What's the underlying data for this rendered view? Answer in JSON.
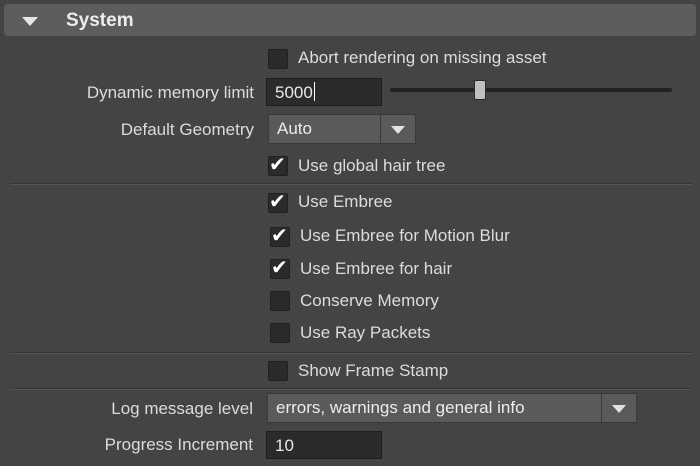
{
  "section": {
    "title": "System",
    "expand_icon": "triangle-down-icon"
  },
  "fields": {
    "abort_missing": {
      "label": "Abort rendering on missing asset",
      "checked": false
    },
    "dynamic_memory": {
      "label": "Dynamic memory limit",
      "value": "5000",
      "slider_fraction": 0.3
    },
    "default_geometry": {
      "label": "Default Geometry",
      "value": "Auto"
    },
    "global_hair_tree": {
      "label": "Use global hair tree",
      "checked": true
    },
    "use_embree": {
      "label": "Use Embree",
      "checked": true
    },
    "embree_motion_blur": {
      "label": "Use Embree for Motion Blur",
      "checked": true
    },
    "embree_hair": {
      "label": "Use Embree for hair",
      "checked": true
    },
    "conserve_memory": {
      "label": "Conserve Memory",
      "checked": false
    },
    "ray_packets": {
      "label": "Use Ray Packets",
      "checked": false
    },
    "frame_stamp": {
      "label": "Show Frame Stamp",
      "checked": false
    },
    "log_level": {
      "label": "Log message level",
      "value": "errors, warnings and general info"
    },
    "progress_increment": {
      "label": "Progress Increment",
      "value": "10"
    }
  },
  "check_glyph": "✔"
}
